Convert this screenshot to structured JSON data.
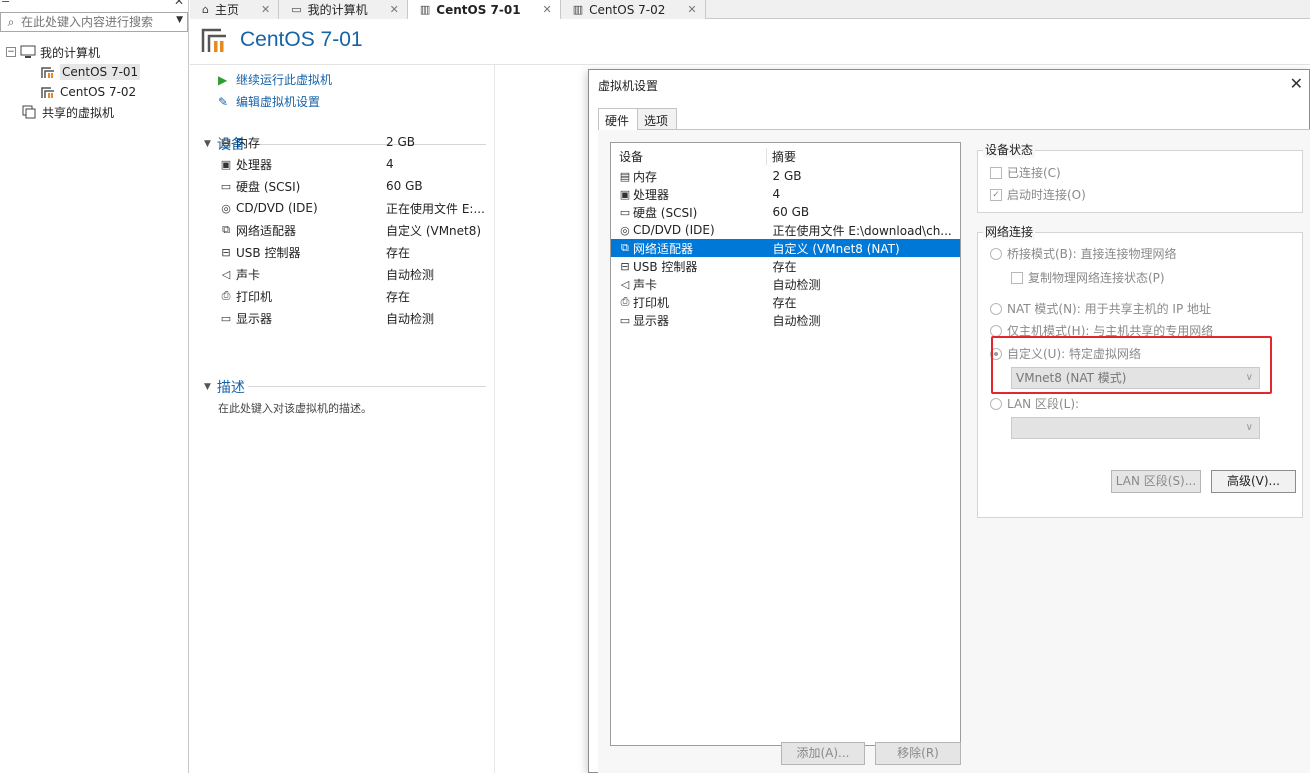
{
  "window": {
    "top_left_glyph": "≛",
    "top_right_glyph": "✕"
  },
  "library": {
    "search_placeholder": "在此处键入内容进行搜索",
    "tree": {
      "root": "我的计算机",
      "children": [
        "CentOS 7-01",
        "CentOS 7-02"
      ],
      "shared": "共享的虚拟机"
    }
  },
  "tabs": [
    {
      "label": "主页",
      "icon": "home-icon"
    },
    {
      "label": "我的计算机",
      "icon": "monitor-icon"
    },
    {
      "label": "CentOS 7-01",
      "icon": "vm-icon"
    },
    {
      "label": "CentOS 7-02",
      "icon": "vm-icon"
    }
  ],
  "vm": {
    "title": "CentOS 7-01",
    "actions": [
      "继续运行此虚拟机",
      "编辑虚拟机设置"
    ],
    "devices_header": "设备",
    "devices": [
      {
        "name": "内存",
        "value": "2 GB",
        "icon": "memory-icon"
      },
      {
        "name": "处理器",
        "value": "4",
        "icon": "cpu-icon"
      },
      {
        "name": "硬盘 (SCSI)",
        "value": "60 GB",
        "icon": "disk-icon"
      },
      {
        "name": "CD/DVD (IDE)",
        "value": "正在使用文件 E:...",
        "icon": "cd-icon"
      },
      {
        "name": "网络适配器",
        "value": "自定义 (VMnet8)",
        "icon": "network-icon"
      },
      {
        "name": "USB 控制器",
        "value": "存在",
        "icon": "usb-icon"
      },
      {
        "name": "声卡",
        "value": "自动检测",
        "icon": "sound-icon"
      },
      {
        "name": "打印机",
        "value": "存在",
        "icon": "printer-icon"
      },
      {
        "name": "显示器",
        "value": "自动检测",
        "icon": "display-icon"
      }
    ],
    "description_header": "描述",
    "description_placeholder": "在此处键入对该虚拟机的描述。"
  },
  "dialog": {
    "title": "虚拟机设置",
    "close": "✕",
    "tabs": [
      "硬件",
      "选项"
    ],
    "list_headers": [
      "设备",
      "摘要"
    ],
    "hardware": [
      {
        "name": "内存",
        "summary": "2 GB"
      },
      {
        "name": "处理器",
        "summary": "4"
      },
      {
        "name": "硬盘 (SCSI)",
        "summary": "60 GB"
      },
      {
        "name": "CD/DVD (IDE)",
        "summary": "正在使用文件 E:\\download\\ch..."
      },
      {
        "name": "网络适配器",
        "summary": "自定义 (VMnet8 (NAT)"
      },
      {
        "name": "USB 控制器",
        "summary": "存在"
      },
      {
        "name": "声卡",
        "summary": "自动检测"
      },
      {
        "name": "打印机",
        "summary": "存在"
      },
      {
        "name": "显示器",
        "summary": "自动检测"
      }
    ],
    "selected_index": 4,
    "add_button": "添加(A)...",
    "remove_button": "移除(R)",
    "device_status": {
      "title": "设备状态",
      "connected": "已连接(C)",
      "connect_at_power_on": "启动时连接(O)"
    },
    "network": {
      "title": "网络连接",
      "bridged": "桥接模式(B): 直接连接物理网络",
      "replicate": "复制物理网络连接状态(P)",
      "nat": "NAT 模式(N): 用于共享主机的 IP 地址",
      "host_only": "仅主机模式(H): 与主机共享的专用网络",
      "custom": "自定义(U): 特定虚拟网络",
      "custom_value": "VMnet8 (NAT 模式)",
      "lan": "LAN 区段(L):",
      "lan_value": ""
    },
    "lan_segments_button": "LAN 区段(S)...",
    "advanced_button": "高级(V)...",
    "highlight_color": "#e2282d"
  }
}
